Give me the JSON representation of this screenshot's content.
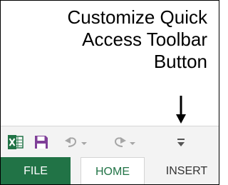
{
  "callout": {
    "lines": [
      "Customize Quick",
      "Access Toolbar",
      "Button"
    ]
  },
  "qat": {
    "icons": {
      "app": "excel-icon",
      "save": "save-icon",
      "undo": "undo-icon",
      "redo": "redo-icon",
      "customize": "customize-quick-access-toolbar-icon"
    },
    "dropdown_glyph": "▾"
  },
  "ribbon": {
    "tabs": [
      {
        "label": "FILE"
      },
      {
        "label": "HOME"
      },
      {
        "label": "INSERT"
      }
    ]
  },
  "colors": {
    "excel_green": "#217346",
    "save_purple": "#7f3f98",
    "toolbar_bg": "#f3f3f3",
    "disabled_gray": "#a6a6a6"
  }
}
